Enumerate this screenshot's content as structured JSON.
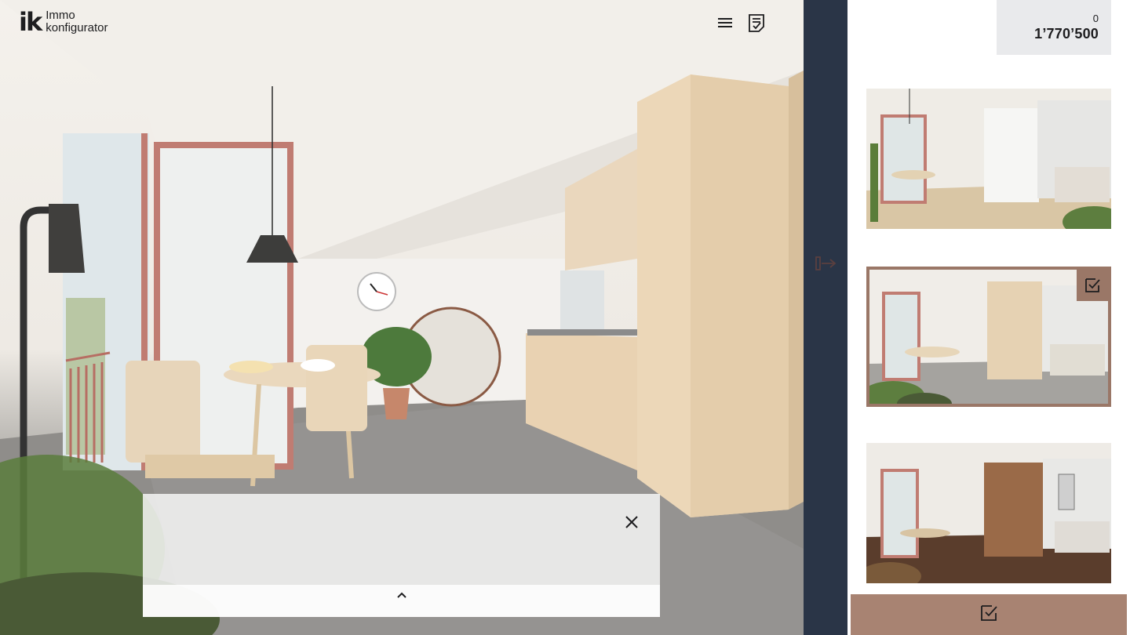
{
  "brand": {
    "mark": "ik",
    "line1": "Immo",
    "line2": "konfigurator"
  },
  "header": {
    "icons": [
      "menu-icon",
      "checklist-icon"
    ]
  },
  "price": {
    "count": "0",
    "total": "1’770’500"
  },
  "info_panel": {
    "icons": [
      "close-icon",
      "chevron-up-icon"
    ]
  },
  "sidebar": {
    "collapse_icon": "collapse-arrow-icon",
    "variants": [
      {
        "id": "variant-1",
        "selected": false
      },
      {
        "id": "variant-2",
        "selected": true
      },
      {
        "id": "variant-3",
        "selected": false
      }
    ],
    "confirm_icon": "checkbox-check-icon"
  },
  "colors": {
    "strip": "#2a3547",
    "accent": "#9a7767",
    "confirm": "#a88372",
    "price_bg": "#e9eaec"
  }
}
